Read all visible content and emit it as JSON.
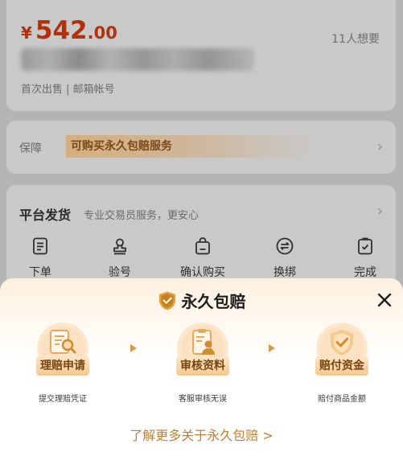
{
  "listing": {
    "currency": "¥",
    "price_int": "542",
    "price_dec": ".00",
    "want_count": "11人想要",
    "subline": "首次出售 | 邮箱帐号"
  },
  "guarantee": {
    "label": "保障",
    "tag": "可购买永久包赔服务"
  },
  "shipping": {
    "title": "平台发货",
    "desc": "专业交易员服务，更安心",
    "steps": [
      {
        "label": "下单",
        "icon": "document-icon"
      },
      {
        "label": "验号",
        "icon": "stamp-icon"
      },
      {
        "label": "确认购买",
        "icon": "bag-icon"
      },
      {
        "label": "换绑",
        "icon": "swap-icon"
      },
      {
        "label": "完成",
        "icon": "check-box-icon"
      }
    ]
  },
  "sheet": {
    "title": "永久包赔",
    "title_icon": "gold-shield-check-icon",
    "close_icon": "close-icon",
    "process": [
      {
        "badge": "理赔申请",
        "caption": "提交理赔凭证",
        "icon": "document-magnifier-icon"
      },
      {
        "badge": "审核资料",
        "caption": "客服审核无误",
        "icon": "profile-card-icon"
      },
      {
        "badge": "赔付资金",
        "caption": "赔付商品金额",
        "icon": "shield-check-icon"
      }
    ],
    "learn_more": "了解更多关于永久包赔 >"
  },
  "colors": {
    "price": "#b3300b",
    "accent_gold": "#c08032",
    "badge_text": "#7a4412",
    "overlay_bg": "#b5b5b5"
  }
}
